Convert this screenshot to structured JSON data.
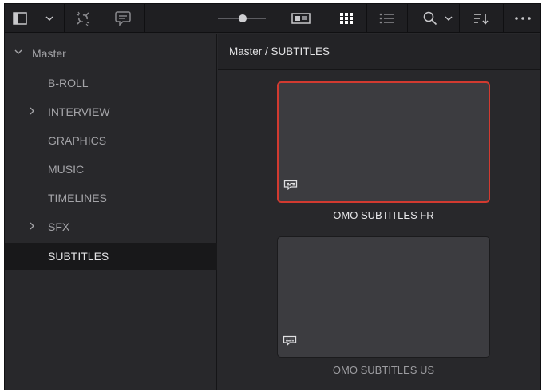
{
  "toolbar": {
    "buttons": [
      {
        "name": "sidebar-toggle",
        "icon": "sidebar-panel-icon"
      },
      {
        "name": "link-clips",
        "icon": "unlink-icon"
      },
      {
        "name": "metadata",
        "icon": "caption-bubble-icon"
      },
      {
        "name": "zoom-slider",
        "level": 0.55
      },
      {
        "name": "metadata-view",
        "icon": "metadata-view-icon"
      },
      {
        "name": "thumbnail-view",
        "icon": "grid-view-icon",
        "active": true
      },
      {
        "name": "list-view",
        "icon": "list-view-icon"
      },
      {
        "name": "search",
        "icon": "search-icon"
      },
      {
        "name": "sort",
        "icon": "sort-icon"
      },
      {
        "name": "more",
        "icon": "more-options-icon"
      }
    ]
  },
  "sidebar": {
    "root": {
      "label": "Master",
      "expanded": true
    },
    "items": [
      {
        "label": "B-ROLL",
        "expandable": false,
        "active": false
      },
      {
        "label": "INTERVIEW",
        "expandable": true,
        "active": false
      },
      {
        "label": "GRAPHICS",
        "expandable": false,
        "active": false
      },
      {
        "label": "MUSIC",
        "expandable": false,
        "active": false
      },
      {
        "label": "TIMELINES",
        "expandable": false,
        "active": false
      },
      {
        "label": "SFX",
        "expandable": true,
        "active": false
      },
      {
        "label": "SUBTITLES",
        "expandable": false,
        "active": true
      }
    ]
  },
  "main": {
    "breadcrumb": "Master / SUBTITLES",
    "clips": [
      {
        "name": "OMO SUBTITLES FR",
        "selected": true,
        "icon": "subtitle-icon"
      },
      {
        "name": "OMO SUBTITLES US",
        "selected": false,
        "icon": "subtitle-icon"
      }
    ]
  },
  "colors": {
    "panel": "#28282b",
    "toolbar": "#1f1f22",
    "selection": "#d23a30",
    "thumbnail": "#3c3c40",
    "active-row": "#18181a"
  }
}
